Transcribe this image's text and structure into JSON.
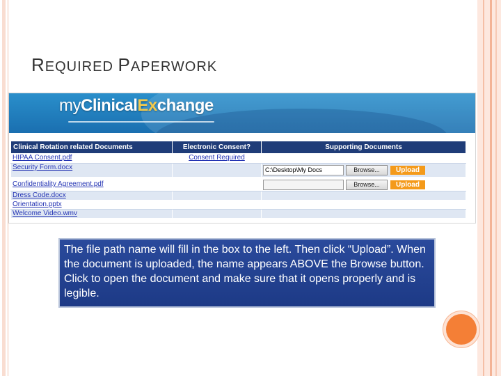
{
  "slide": {
    "title_cap1": "R",
    "title_rest1": "EQUIRED ",
    "title_cap2": "P",
    "title_rest2": "APERWORK"
  },
  "brand": {
    "my": "my",
    "name": "Clinical",
    "ex": "Ex",
    "rest": "change"
  },
  "table": {
    "headers": [
      "Clinical Rotation related Documents",
      "Electronic Consent?",
      "Supporting Documents"
    ],
    "rows": [
      {
        "doc": "HIPAA Consent.pdf",
        "consent": "Consent Required"
      },
      {
        "doc": "Security Form.docx",
        "path": "C:\\Desktop\\My Docs",
        "browse": "Browse...",
        "upload": "Upload"
      },
      {
        "doc": "Confidentiality Agreement.pdf",
        "path": "",
        "browse": "Browse...",
        "upload": "Upload"
      },
      {
        "doc": "Dress Code.docx"
      },
      {
        "doc": "Orientation.pptx"
      },
      {
        "doc": "Welcome Video.wmv"
      }
    ]
  },
  "callout": "The file path name will fill in the box to the left.  Then click “Upload”.  When the document is uploaded, the name appears ABOVE the Browse button.  Click to open the document and make sure that it opens properly and is legible.",
  "colors": {
    "header": "#1f3c78",
    "upload": "#f49a1a",
    "callout": "#1d3a86",
    "accent": "#f47f36"
  }
}
